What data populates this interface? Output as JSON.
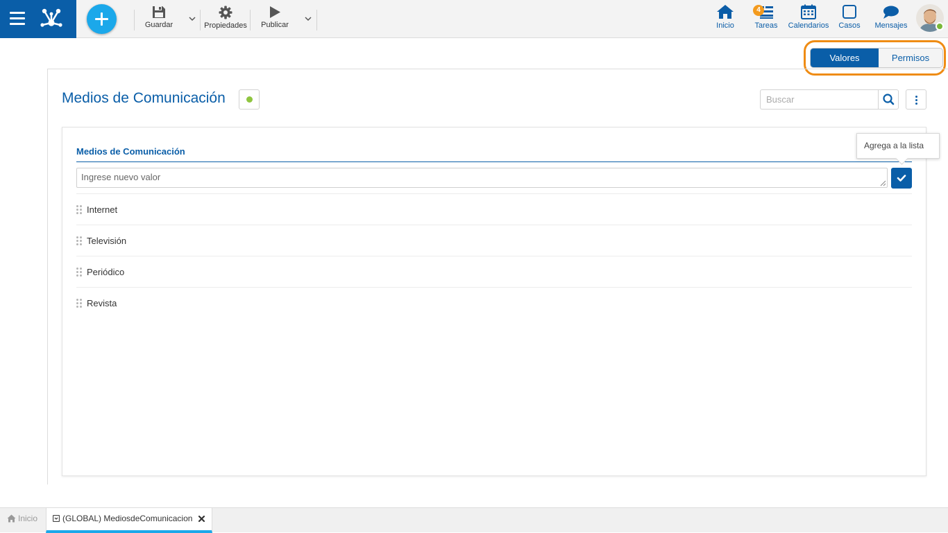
{
  "toolbar": {
    "save_label": "Guardar",
    "properties_label": "Propiedades",
    "publish_label": "Publicar"
  },
  "nav": {
    "home_label": "Inicio",
    "tasks_label": "Tareas",
    "tasks_badge": "4",
    "calendars_label": "Calendarios",
    "cases_label": "Casos",
    "messages_label": "Mensajes"
  },
  "view_toggle": {
    "values_label": "Valores",
    "permissions_label": "Permisos",
    "selected": "Valores"
  },
  "page": {
    "title": "Medios de Comunicación",
    "search_placeholder": "Buscar"
  },
  "list_card": {
    "title": "Medios de Comunicación",
    "input_placeholder": "Ingrese nuevo valor",
    "add_tooltip": "Agrega a la lista",
    "items": [
      "Internet",
      "Televisión",
      "Periódico",
      "Revista"
    ]
  },
  "bottom_tabs": {
    "home_label": "Inicio",
    "active_tab_label": "(GLOBAL) MediosdeComunicacion"
  },
  "colors": {
    "primary": "#0a5ea8",
    "accent": "#1ba8ea",
    "highlight": "#ef8c14",
    "status_ok": "#8fc540",
    "badge": "#f39a1d"
  }
}
